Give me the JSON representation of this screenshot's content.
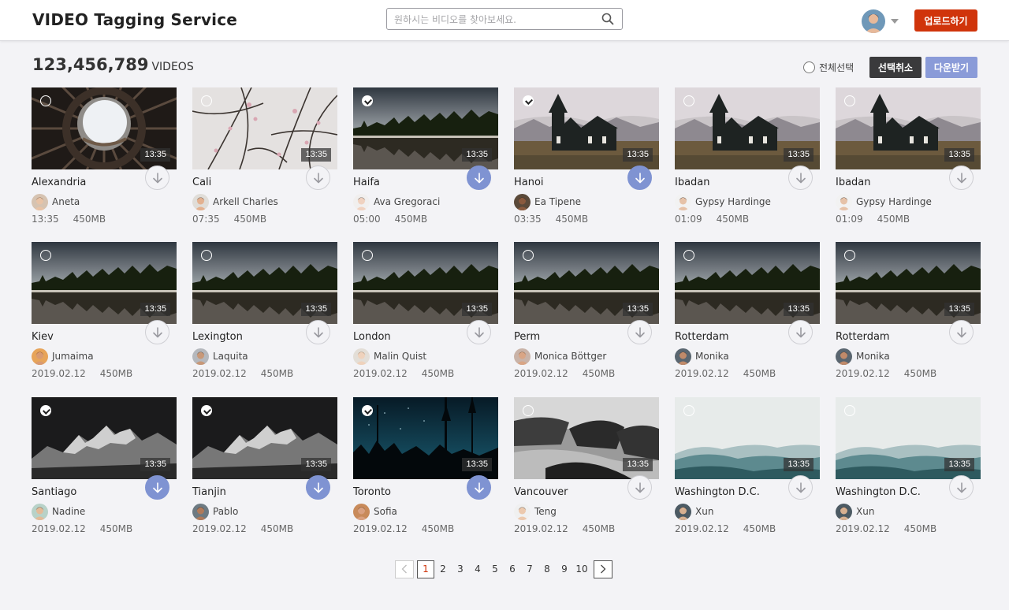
{
  "app": {
    "title": "VIDEO Tagging Service",
    "search_placeholder": "원하시는 비디오를 찾아보세요.",
    "upload_label": "업로드하기"
  },
  "toolbar": {
    "count": "123,456,789",
    "count_unit": "VIDEOS",
    "select_all_label": "전체선택",
    "deselect_label": "선택취소",
    "download_label": "다운받기"
  },
  "videos": [
    {
      "title": "Alexandria",
      "author": "Aneta",
      "date": "13:35",
      "size": "450MB",
      "duration": "13:35",
      "selected": false,
      "scene": "tunnel"
    },
    {
      "title": "Cali",
      "author": "Arkell Charles",
      "date": "07:35",
      "size": "450MB",
      "duration": "13:35",
      "selected": false,
      "scene": "blossom"
    },
    {
      "title": "Haifa",
      "author": "Ava Gregoraci",
      "date": "05:00",
      "size": "450MB",
      "duration": "13:35",
      "selected": true,
      "scene": "lake"
    },
    {
      "title": "Hanoi",
      "author": "Ea Tipene",
      "date": "03:35",
      "size": "450MB",
      "duration": "13:35",
      "selected": true,
      "scene": "church"
    },
    {
      "title": "Ibadan",
      "author": "Gypsy Hardinge",
      "date": "01:09",
      "size": "450MB",
      "duration": "13:35",
      "selected": false,
      "scene": "church"
    },
    {
      "title": "Ibadan",
      "author": "Gypsy Hardinge",
      "date": "01:09",
      "size": "450MB",
      "duration": "13:35",
      "selected": false,
      "scene": "church"
    },
    {
      "title": "Kiev",
      "author": "Jumaima",
      "date": "2019.02.12",
      "size": "450MB",
      "duration": "13:35",
      "selected": false,
      "scene": "lake"
    },
    {
      "title": "Lexington",
      "author": "Laquita",
      "date": "2019.02.12",
      "size": "450MB",
      "duration": "13:35",
      "selected": false,
      "scene": "lake"
    },
    {
      "title": "London",
      "author": "Malin Quist",
      "date": "2019.02.12",
      "size": "450MB",
      "duration": "13:35",
      "selected": false,
      "scene": "lake"
    },
    {
      "title": "Perm",
      "author": "Monica Bӧttger",
      "date": "2019.02.12",
      "size": "450MB",
      "duration": "13:35",
      "selected": false,
      "scene": "lake"
    },
    {
      "title": "Rotterdam",
      "author": "Monika",
      "date": "2019.02.12",
      "size": "450MB",
      "duration": "13:35",
      "selected": false,
      "scene": "lake"
    },
    {
      "title": "Rotterdam",
      "author": "Monika",
      "date": "2019.02.12",
      "size": "450MB",
      "duration": "13:35",
      "selected": false,
      "scene": "lake"
    },
    {
      "title": "Santiago",
      "author": "Nadine",
      "date": "2019.02.12",
      "size": "450MB",
      "duration": "13:35",
      "selected": true,
      "scene": "mountain"
    },
    {
      "title": "Tianjin",
      "author": "Pablo",
      "date": "2019.02.12",
      "size": "450MB",
      "duration": "13:35",
      "selected": true,
      "scene": "mountain"
    },
    {
      "title": "Toronto",
      "author": "Sofia",
      "date": "2019.02.12",
      "size": "450MB",
      "duration": "13:35",
      "selected": true,
      "scene": "forest-night"
    },
    {
      "title": "Vancouver",
      "author": "Teng",
      "date": "2019.02.12",
      "size": "450MB",
      "duration": "13:35",
      "selected": false,
      "scene": "sea-rocks"
    },
    {
      "title": "Washington D.C.",
      "author": "Xun",
      "date": "2019.02.12",
      "size": "450MB",
      "duration": "13:35",
      "selected": false,
      "scene": "hills"
    },
    {
      "title": "Washington D.C.",
      "author": "Xun",
      "date": "2019.02.12",
      "size": "450MB",
      "duration": "13:35",
      "selected": false,
      "scene": "hills"
    }
  ],
  "pagination": {
    "pages": [
      "1",
      "2",
      "3",
      "4",
      "5",
      "6",
      "7",
      "8",
      "9",
      "10"
    ],
    "current": "1"
  }
}
